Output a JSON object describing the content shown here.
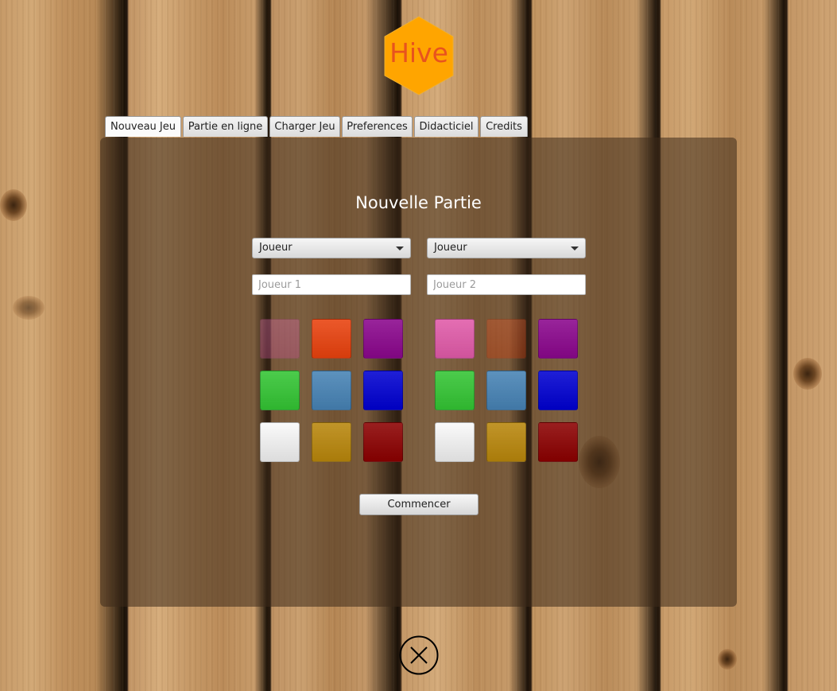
{
  "logo": {
    "text": "Hive",
    "hex_color": "#ffa500",
    "text_color": "#e8531e"
  },
  "tabs": [
    {
      "label": "Nouveau Jeu",
      "active": true
    },
    {
      "label": "Partie en ligne",
      "active": false
    },
    {
      "label": "Charger Jeu",
      "active": false
    },
    {
      "label": "Preferences",
      "active": false
    },
    {
      "label": "Didacticiel",
      "active": false
    },
    {
      "label": "Credits",
      "active": false
    }
  ],
  "panel": {
    "title": "Nouvelle Partie"
  },
  "players": [
    {
      "type_select": "Joueur",
      "name_placeholder": "Joueur 1",
      "name_value": "",
      "colors": [
        {
          "name": "pink",
          "hex": "#e05aa8",
          "selected": true
        },
        {
          "name": "orange-red",
          "hex": "#e8410d",
          "selected": false
        },
        {
          "name": "purple",
          "hex": "#8a068c",
          "selected": false
        },
        {
          "name": "green",
          "hex": "#33c433",
          "selected": false
        },
        {
          "name": "steel-blue",
          "hex": "#4682b4",
          "selected": false
        },
        {
          "name": "blue",
          "hex": "#0000d0",
          "selected": false
        },
        {
          "name": "white",
          "hex": "#f2f2f2",
          "selected": false
        },
        {
          "name": "gold",
          "hex": "#b8860b",
          "selected": false
        },
        {
          "name": "dark-red",
          "hex": "#8b0000",
          "selected": false
        }
      ]
    },
    {
      "type_select": "Joueur",
      "name_placeholder": "Joueur 2",
      "name_value": "",
      "colors": [
        {
          "name": "pink",
          "hex": "#e05aa8",
          "selected": false
        },
        {
          "name": "orange-red",
          "hex": "#e8410d",
          "selected": true
        },
        {
          "name": "purple",
          "hex": "#8a068c",
          "selected": false
        },
        {
          "name": "green",
          "hex": "#33c433",
          "selected": false
        },
        {
          "name": "steel-blue",
          "hex": "#4682b4",
          "selected": false
        },
        {
          "name": "blue",
          "hex": "#0000d0",
          "selected": false
        },
        {
          "name": "white",
          "hex": "#f2f2f2",
          "selected": false
        },
        {
          "name": "gold",
          "hex": "#b8860b",
          "selected": false
        },
        {
          "name": "dark-red",
          "hex": "#8b0000",
          "selected": false
        }
      ]
    }
  ],
  "start_button": {
    "label": "Commencer"
  },
  "close_button": {
    "icon": "close-circle-icon"
  }
}
